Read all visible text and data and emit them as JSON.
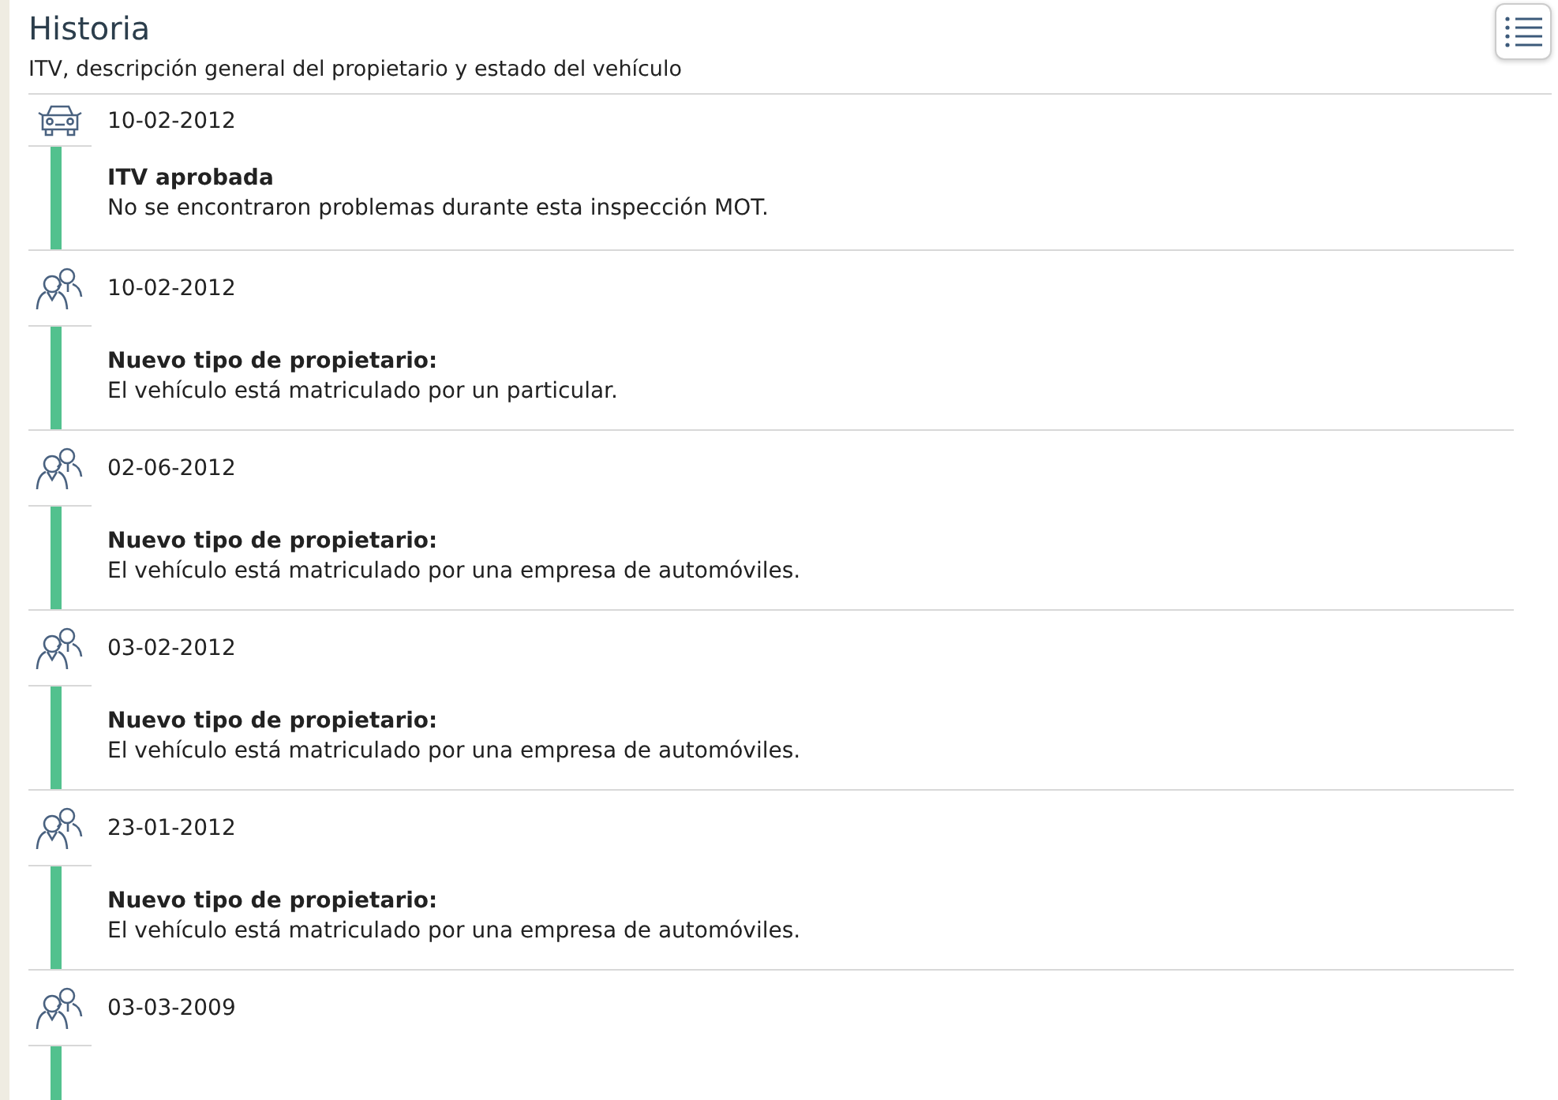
{
  "header": {
    "title": "Historia",
    "subtitle": "ITV, descripción general del propietario y estado del vehículo"
  },
  "events": [
    {
      "kind": "inspection",
      "date": "10-02-2012",
      "title": "ITV aprobada",
      "text": "No se encontraron problemas durante esta inspección MOT."
    },
    {
      "kind": "owner",
      "date": "10-02-2012",
      "title": "Nuevo tipo de propietario:",
      "text": "El vehículo está matriculado por un particular."
    },
    {
      "kind": "owner",
      "date": "02-06-2012",
      "title": "Nuevo tipo de propietario:",
      "text": "El vehículo está matriculado por una empresa de automóviles."
    },
    {
      "kind": "owner",
      "date": "03-02-2012",
      "title": "Nuevo tipo de propietario:",
      "text": "El vehículo está matriculado por una empresa de automóviles."
    },
    {
      "kind": "owner",
      "date": "23-01-2012",
      "title": "Nuevo tipo de propietario:",
      "text": "El vehículo está matriculado por una empresa de automóviles."
    },
    {
      "kind": "owner",
      "date": "03-03-2009"
    }
  ]
}
